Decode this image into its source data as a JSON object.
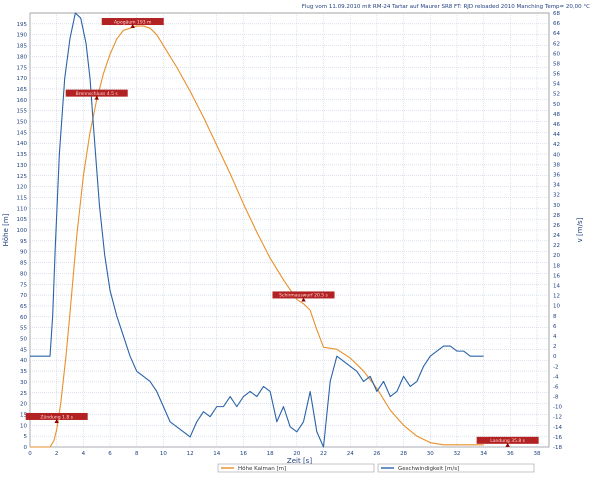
{
  "chart_data": {
    "type": "line",
    "title": "Flug vom 11.09.2010 mit RM-24 Tartar auf Maurer SR8 FT: RJD reloaded 2010 Manching Temp= 20,00 °C",
    "xlabel": "Zeit [s]",
    "ylabel_left": "Höhe [m]",
    "ylabel_right": "v [m/s]",
    "xlim": [
      0,
      34
    ],
    "x_ticks": [
      0,
      2,
      4,
      6,
      8,
      10,
      12,
      14,
      16,
      18,
      20,
      22,
      24,
      26,
      28,
      30,
      32,
      34,
      36,
      38
    ],
    "ylim_left": [
      0,
      200
    ],
    "y_left_ticks": [
      0,
      5,
      10,
      15,
      20,
      25,
      30,
      35,
      40,
      45,
      50,
      55,
      60,
      65,
      70,
      75,
      80,
      85,
      90,
      95,
      100,
      105,
      110,
      115,
      120,
      125,
      130,
      135,
      140,
      145,
      150,
      155,
      160,
      165,
      170,
      175,
      180,
      185,
      190,
      195
    ],
    "ylim_right": [
      -18,
      68
    ],
    "y_right_ticks": [
      -18,
      -16,
      -14,
      -12,
      -10,
      -8,
      -6,
      -4,
      -2,
      0,
      2,
      4,
      6,
      8,
      10,
      12,
      14,
      16,
      18,
      20,
      22,
      24,
      26,
      28,
      30,
      32,
      34,
      36,
      38,
      40,
      42,
      44,
      46,
      48,
      50,
      52,
      54,
      56,
      58,
      60,
      62,
      64,
      66,
      68
    ],
    "grid": true,
    "legend_position": "bottom",
    "series": [
      {
        "name": "Höhe Kalman [m]",
        "axis": "left",
        "color": "#e8902a",
        "x": [
          0,
          1.5,
          1.8,
          2.0,
          2.3,
          2.7,
          3.0,
          3.5,
          4.0,
          4.5,
          5.0,
          5.5,
          6.0,
          6.5,
          7.0,
          7.5,
          8.0,
          8.5,
          9.0,
          9.5,
          10.0,
          11.0,
          12.0,
          13.0,
          14.0,
          15.0,
          16.0,
          17.0,
          18.0,
          19.0,
          20.0,
          20.5,
          21.0,
          21.5,
          22.0,
          23.0,
          24.0,
          25.0,
          26.0,
          27.0,
          28.0,
          29.0,
          30.0,
          31.0,
          32.0,
          33.0,
          34.0
        ],
        "values": [
          0,
          0,
          3,
          8,
          20,
          42,
          62,
          97,
          125,
          145,
          160,
          172,
          181,
          188,
          192,
          193,
          194,
          194,
          193,
          190,
          185,
          175,
          164,
          152,
          139,
          126,
          112,
          99,
          87,
          77,
          68,
          66,
          63,
          54,
          46,
          45,
          41,
          35,
          27,
          17,
          10,
          5,
          2,
          1,
          1,
          1,
          1
        ]
      },
      {
        "name": "Geschwindigkeit [m/s]",
        "axis": "right",
        "color": "#2a63a8",
        "x": [
          0,
          1.5,
          1.7,
          1.9,
          2.2,
          2.6,
          3.0,
          3.4,
          3.8,
          4.2,
          4.5,
          4.8,
          5.2,
          5.6,
          6.0,
          6.5,
          7.0,
          7.5,
          8.0,
          8.5,
          9.0,
          9.5,
          10.0,
          10.5,
          11.0,
          11.5,
          12.0,
          12.5,
          13.0,
          13.5,
          14.0,
          14.5,
          15.0,
          15.5,
          16.0,
          16.5,
          17.0,
          17.5,
          18.0,
          18.5,
          19.0,
          19.5,
          20.0,
          20.5,
          21.0,
          21.5,
          22.0,
          22.5,
          23.0,
          23.5,
          24.0,
          24.5,
          25.0,
          25.5,
          26.0,
          26.5,
          27.0,
          27.5,
          28.0,
          28.5,
          29.0,
          29.5,
          30.0,
          30.5,
          31.0,
          31.5,
          32.0,
          32.5,
          33.0,
          33.5,
          34.0
        ],
        "values": [
          0,
          0,
          8,
          22,
          40,
          55,
          63,
          68,
          67,
          62,
          55,
          44,
          30,
          20,
          13,
          8,
          4,
          0,
          -3,
          -4,
          -5,
          -7,
          -10,
          -13,
          -14,
          -15,
          -16,
          -13,
          -11,
          -12,
          -10,
          -10,
          -8,
          -10,
          -8,
          -7,
          -8,
          -6,
          -7,
          -13,
          -10,
          -14,
          -15,
          -13,
          -7,
          -15,
          -18,
          -5,
          0,
          -1,
          -2,
          -3,
          -5,
          -4,
          -7,
          -5,
          -8,
          -7,
          -4,
          -6,
          -5,
          -2,
          0,
          1,
          2,
          2,
          1,
          1,
          0,
          0,
          0
        ]
      }
    ],
    "annotations": [
      {
        "x": 2.0,
        "y": 12,
        "axis": "left",
        "label": "Zündung 1.8 s"
      },
      {
        "x": 5.0,
        "y": 161,
        "axis": "left",
        "label": "Brennschluss 4.5 s"
      },
      {
        "x": 7.7,
        "y": 194,
        "axis": "left",
        "label": "Apogäum 193 m"
      },
      {
        "x": 20.5,
        "y": 68,
        "axis": "left",
        "label": "Schirmauswurf 20.5 s"
      },
      {
        "x": 35.8,
        "y": 1,
        "axis": "left",
        "label": "Landung 35.8 s"
      }
    ]
  },
  "colors": {
    "grid": "#b8c7dc",
    "axis_text": "#1f3f7f",
    "annotation_bg": "#b22222",
    "annotation_marker": "#8b0000"
  }
}
